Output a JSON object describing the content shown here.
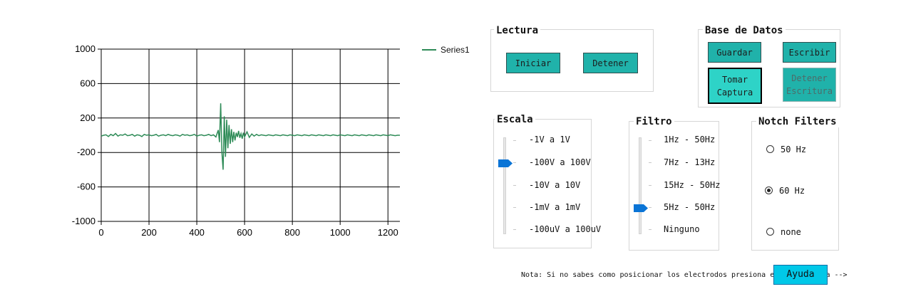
{
  "chart_data": {
    "type": "line",
    "title": "",
    "xlabel": "",
    "ylabel": "",
    "xlim": [
      0,
      1250
    ],
    "ylim": [
      -1000,
      1000
    ],
    "x_ticks": [
      "0",
      "200",
      "400",
      "600",
      "800",
      "1000",
      "1200"
    ],
    "y_ticks": [
      "1000",
      "600",
      "200",
      "-200",
      "-600",
      "-1000"
    ],
    "grid": true,
    "legend": "top-right",
    "series": [
      {
        "name": "Series1",
        "color": "#2e8b57",
        "points": [
          [
            0,
            -10
          ],
          [
            10,
            0
          ],
          [
            20,
            5
          ],
          [
            30,
            -15
          ],
          [
            40,
            10
          ],
          [
            50,
            -5
          ],
          [
            60,
            20
          ],
          [
            70,
            -10
          ],
          [
            80,
            5
          ],
          [
            90,
            0
          ],
          [
            100,
            15
          ],
          [
            110,
            -5
          ],
          [
            120,
            0
          ],
          [
            130,
            10
          ],
          [
            140,
            -10
          ],
          [
            150,
            5
          ],
          [
            160,
            0
          ],
          [
            170,
            -15
          ],
          [
            180,
            10
          ],
          [
            190,
            0
          ],
          [
            200,
            5
          ],
          [
            210,
            -5
          ],
          [
            220,
            0
          ],
          [
            230,
            10
          ],
          [
            240,
            -10
          ],
          [
            250,
            0
          ],
          [
            260,
            5
          ],
          [
            270,
            -5
          ],
          [
            280,
            10
          ],
          [
            290,
            0
          ],
          [
            300,
            -5
          ],
          [
            310,
            5
          ],
          [
            320,
            0
          ],
          [
            330,
            -10
          ],
          [
            340,
            10
          ],
          [
            350,
            0
          ],
          [
            360,
            5
          ],
          [
            370,
            -5
          ],
          [
            380,
            0
          ],
          [
            390,
            10
          ],
          [
            400,
            -10
          ],
          [
            410,
            0
          ],
          [
            420,
            5
          ],
          [
            430,
            -5
          ],
          [
            440,
            0
          ],
          [
            450,
            10
          ],
          [
            460,
            -5
          ],
          [
            470,
            5
          ],
          [
            480,
            -20
          ],
          [
            490,
            60
          ],
          [
            495,
            -80
          ],
          [
            500,
            370
          ],
          [
            505,
            -200
          ],
          [
            510,
            -400
          ],
          [
            515,
            220
          ],
          [
            520,
            -250
          ],
          [
            525,
            180
          ],
          [
            530,
            -150
          ],
          [
            535,
            120
          ],
          [
            540,
            -100
          ],
          [
            545,
            70
          ],
          [
            550,
            -80
          ],
          [
            555,
            40
          ],
          [
            560,
            -60
          ],
          [
            565,
            30
          ],
          [
            570,
            -20
          ],
          [
            575,
            50
          ],
          [
            580,
            -30
          ],
          [
            585,
            20
          ],
          [
            590,
            -40
          ],
          [
            595,
            30
          ],
          [
            600,
            -20
          ],
          [
            610,
            40
          ],
          [
            620,
            -25
          ],
          [
            630,
            15
          ],
          [
            640,
            -10
          ],
          [
            650,
            10
          ],
          [
            660,
            -5
          ],
          [
            670,
            5
          ],
          [
            680,
            0
          ],
          [
            690,
            -5
          ],
          [
            700,
            5
          ],
          [
            710,
            0
          ],
          [
            720,
            -5
          ],
          [
            730,
            5
          ],
          [
            740,
            0
          ],
          [
            750,
            -5
          ],
          [
            760,
            5
          ],
          [
            770,
            0
          ],
          [
            780,
            -5
          ],
          [
            790,
            5
          ],
          [
            800,
            0
          ],
          [
            810,
            -5
          ],
          [
            820,
            5
          ],
          [
            830,
            0
          ],
          [
            840,
            -5
          ],
          [
            850,
            5
          ],
          [
            860,
            0
          ],
          [
            870,
            -5
          ],
          [
            880,
            5
          ],
          [
            890,
            0
          ],
          [
            900,
            -5
          ],
          [
            910,
            5
          ],
          [
            920,
            0
          ],
          [
            930,
            -5
          ],
          [
            940,
            5
          ],
          [
            950,
            0
          ],
          [
            960,
            -5
          ],
          [
            970,
            5
          ],
          [
            980,
            0
          ],
          [
            990,
            -5
          ],
          [
            1000,
            5
          ],
          [
            1010,
            0
          ],
          [
            1020,
            -5
          ],
          [
            1030,
            5
          ],
          [
            1040,
            0
          ],
          [
            1050,
            -5
          ],
          [
            1060,
            5
          ],
          [
            1070,
            0
          ],
          [
            1080,
            -5
          ],
          [
            1090,
            5
          ],
          [
            1100,
            0
          ],
          [
            1110,
            -5
          ],
          [
            1120,
            5
          ],
          [
            1130,
            0
          ],
          [
            1140,
            -5
          ],
          [
            1150,
            5
          ],
          [
            1160,
            0
          ],
          [
            1170,
            -5
          ],
          [
            1180,
            5
          ],
          [
            1190,
            0
          ],
          [
            1200,
            -5
          ],
          [
            1210,
            5
          ],
          [
            1220,
            0
          ],
          [
            1230,
            -5
          ],
          [
            1240,
            0
          ],
          [
            1250,
            0
          ]
        ]
      }
    ]
  },
  "lectura": {
    "title": "Lectura",
    "iniciar_label": "Iniciar",
    "detener_label": "Detener"
  },
  "base_datos": {
    "title": "Base de Datos",
    "guardar_label": "Guardar",
    "escribir_label": "Escribir",
    "captura_label_1": "Tomar",
    "captura_label_2": "Captura",
    "detener_escritura_label_1": "Detener",
    "detener_escritura_label_2": "Escritura"
  },
  "escala": {
    "title": "Escala",
    "options": [
      "-1V a 1V",
      "-100V a 100V",
      "-10V a 10V",
      "-1mV a 1mV",
      "-100uV a 100uV"
    ],
    "selected_index": 1
  },
  "filtro": {
    "title": "Filtro",
    "options": [
      "1Hz - 50Hz",
      "7Hz - 13Hz",
      "15Hz - 50Hz",
      "5Hz - 50Hz",
      "Ninguno"
    ],
    "selected_index": 3
  },
  "notch": {
    "title": "Notch Filters",
    "options": [
      "50 Hz",
      "60 Hz",
      "none"
    ],
    "selected_index": 1
  },
  "footer": {
    "note": "Nota: Si no sabes como posicionar los electrodos presiona el boton ayuda -->",
    "help_label": "Ayuda"
  },
  "colors": {
    "button_bg": "#20b2aa",
    "button_focused_bg": "#2ed3c7",
    "help_bg": "#00c8e8",
    "thumb": "#0a74d6",
    "series": "#2e8b57"
  }
}
